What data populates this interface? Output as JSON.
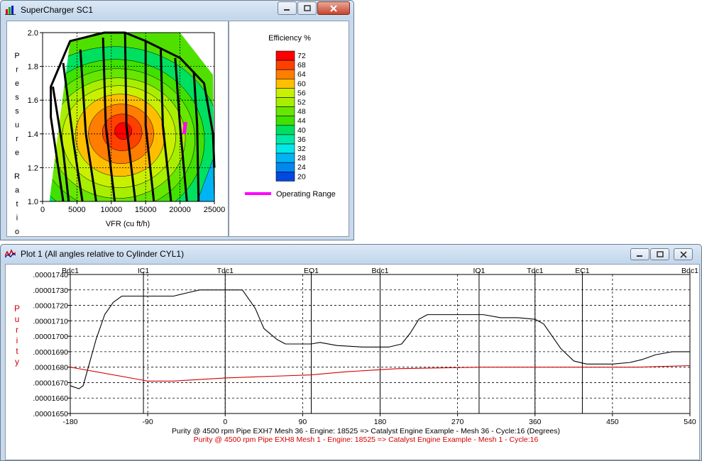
{
  "win1": {
    "title": "SuperCharger SC1",
    "chart_data": {
      "type": "heatmap",
      "xlabel": "VFR  (cu ft/h)",
      "ylabel": "Pressure Ratio",
      "xlim": [
        0,
        25000
      ],
      "ylim": [
        1.0,
        2.0
      ],
      "x_ticks": [
        "0",
        "5000",
        "10000",
        "15000",
        "20000",
        "25000"
      ],
      "y_ticks": [
        "1.0",
        "1.2",
        "1.4",
        "1.6",
        "1.8",
        "2.0"
      ],
      "grid": true,
      "legend_title": "Efficiency %",
      "legend": [
        {
          "label": "72",
          "color": "#ff0000"
        },
        {
          "label": "68",
          "color": "#ff4000"
        },
        {
          "label": "64",
          "color": "#ff7d00"
        },
        {
          "label": "60",
          "color": "#ffbf00"
        },
        {
          "label": "56",
          "color": "#c8f000"
        },
        {
          "label": "52",
          "color": "#a8ee00"
        },
        {
          "label": "48",
          "color": "#66e600"
        },
        {
          "label": "44",
          "color": "#40e000"
        },
        {
          "label": "40",
          "color": "#00e060"
        },
        {
          "label": "36",
          "color": "#00e8a8"
        },
        {
          "label": "32",
          "color": "#00e8e8"
        },
        {
          "label": "28",
          "color": "#00b4f4"
        },
        {
          "label": "24",
          "color": "#0088f0"
        },
        {
          "label": "20",
          "color": "#0048e0"
        }
      ],
      "operating_range_label": "Operating Range",
      "operating_range_color": "#ff00ff"
    }
  },
  "win2": {
    "title": "Plot 1 (All angles relative to Cylinder CYL1)",
    "chart_data": {
      "type": "line",
      "ylabel": "Purity",
      "xlim": [
        -180,
        540
      ],
      "ylim": [
        1.65e-05,
        1.74e-05
      ],
      "x_ticks": [
        "-180",
        "-90",
        "0",
        "90",
        "180",
        "270",
        "360",
        "450",
        "540"
      ],
      "y_ticks": [
        ".00001650",
        ".00001660",
        ".00001670",
        ".00001680",
        ".00001690",
        ".00001700",
        ".00001710",
        ".00001720",
        ".00001730",
        ".00001740"
      ],
      "events": [
        {
          "label": "Bdc1",
          "x": -180
        },
        {
          "label": "IC1",
          "x": -95
        },
        {
          "label": "Tdc1",
          "x": 0
        },
        {
          "label": "EO1",
          "x": 100
        },
        {
          "label": "Bdc1",
          "x": 180
        },
        {
          "label": "IO1",
          "x": 295
        },
        {
          "label": "Tdc1",
          "x": 360
        },
        {
          "label": "EC1",
          "x": 415
        },
        {
          "label": "Bdc1",
          "x": 540
        }
      ],
      "series": [
        {
          "name": "Purity @ 4500 rpm Pipe EXH7 Mesh 36 - Engine: 18525 => Catalyst Engine Example -  Mesh 36 - Cycle:16 (Degrees)",
          "color": "#000000",
          "x": [
            -180,
            -170,
            -165,
            -158,
            -150,
            -140,
            -130,
            -120,
            -110,
            -100,
            -90,
            -60,
            -45,
            -30,
            0,
            20,
            25,
            35,
            45,
            60,
            70,
            85,
            100,
            110,
            130,
            160,
            190,
            205,
            215,
            225,
            235,
            245,
            300,
            320,
            340,
            360,
            370,
            380,
            390,
            405,
            420,
            450,
            470,
            485,
            500,
            520,
            540
          ],
          "y": [
            1.668e-05,
            1.666e-05,
            1.668e-05,
            1.682e-05,
            1.698e-05,
            1.714e-05,
            1.722e-05,
            1.726e-05,
            1.726e-05,
            1.726e-05,
            1.726e-05,
            1.726e-05,
            1.728e-05,
            1.73e-05,
            1.73e-05,
            1.73e-05,
            1.726e-05,
            1.718e-05,
            1.705e-05,
            1.698e-05,
            1.695e-05,
            1.695e-05,
            1.695e-05,
            1.696e-05,
            1.694e-05,
            1.693e-05,
            1.693e-05,
            1.695e-05,
            1.702e-05,
            1.711e-05,
            1.714e-05,
            1.714e-05,
            1.714e-05,
            1.712e-05,
            1.712e-05,
            1.711e-05,
            1.708e-05,
            1.7e-05,
            1.692e-05,
            1.684e-05,
            1.682e-05,
            1.682e-05,
            1.683e-05,
            1.685e-05,
            1.688e-05,
            1.69e-05,
            1.69e-05
          ]
        },
        {
          "name": "Purity @ 4500 rpm Pipe EXH8 Mesh 1 - Engine: 18525 => Catalyst Engine Example -  Mesh 1 - Cycle:16",
          "color": "#d40000",
          "x": [
            -180,
            -90,
            -60,
            0,
            100,
            140,
            200,
            300,
            400,
            480,
            540
          ],
          "y": [
            1.68e-05,
            1.671e-05,
            1.671e-05,
            1.673e-05,
            1.675e-05,
            1.677e-05,
            1.679e-05,
            1.68e-05,
            1.68e-05,
            1.68e-05,
            1.681e-05
          ]
        }
      ]
    }
  }
}
